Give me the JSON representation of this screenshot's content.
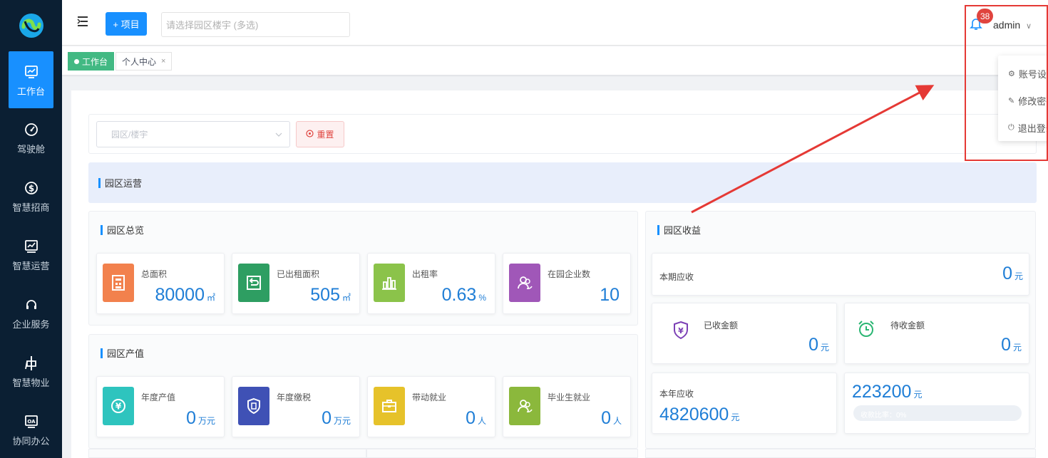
{
  "sidebar": {
    "logo_icon": "brand-logo-icon",
    "items": [
      {
        "label": "工作台",
        "icon": "monitor-chart-icon",
        "active": true
      },
      {
        "label": "驾驶舱",
        "icon": "speedometer-icon",
        "active": false
      },
      {
        "label": "智慧招商",
        "icon": "dollar-coin-icon",
        "active": false
      },
      {
        "label": "智慧运营",
        "icon": "line-chart-icon",
        "active": false
      },
      {
        "label": "企业服务",
        "icon": "headset-icon",
        "active": false
      },
      {
        "label": "智慧物业",
        "icon": "property-icon",
        "active": false
      },
      {
        "label": "协同办公",
        "icon": "oa-icon",
        "active": false
      }
    ]
  },
  "header": {
    "add_button": "+ 项目",
    "park_placeholder": "请选择园区楼宇 (多选)",
    "notification_count": "38",
    "username": "admin",
    "user_chevron": "∨"
  },
  "tags": {
    "workbench": "工作台",
    "personal": "个人中心",
    "close": "×"
  },
  "user_menu": {
    "items": [
      {
        "label": "账号设置",
        "icon": "gear-icon"
      },
      {
        "label": "修改密码",
        "icon": "pen-icon"
      },
      {
        "label": "退出登录",
        "icon": "power-icon"
      }
    ]
  },
  "filter": {
    "park_placeholder": "园区/楼宇",
    "reset_label": "重置"
  },
  "operations": {
    "title": "园区运营"
  },
  "overview": {
    "title": "园区总览",
    "cards": [
      {
        "label": "总面积",
        "value": "80000",
        "unit": "㎡",
        "color": "#f2814d"
      },
      {
        "label": "已出租面积",
        "value": "505",
        "unit": "㎡",
        "color": "#2e9e62"
      },
      {
        "label": "出租率",
        "value": "0.63",
        "unit": "%",
        "color": "#8bc34a"
      },
      {
        "label": "在园企业数",
        "value": "10",
        "unit": "",
        "color": "#a057b8"
      }
    ]
  },
  "output": {
    "title": "园区产值",
    "cards": [
      {
        "label": "年度产值",
        "value": "0",
        "unit": "万元",
        "color": "#2ec4be"
      },
      {
        "label": "年度缴税",
        "value": "0",
        "unit": "万元",
        "color": "#3f51b5"
      },
      {
        "label": "带动就业",
        "value": "0",
        "unit": "人",
        "color": "#e6c22a"
      },
      {
        "label": "毕业生就业",
        "value": "0",
        "unit": "人",
        "color": "#8bb83c"
      }
    ]
  },
  "revenue": {
    "title": "园区收益",
    "current_receivable_label": "本期应收",
    "current_receivable_value": "0",
    "current_receivable_unit": "元",
    "collected_label": "已收金额",
    "collected_value": "0",
    "collected_unit": "元",
    "pending_label": "待收金额",
    "pending_value": "0",
    "pending_unit": "元",
    "annual_receivable_label": "本年应收",
    "annual_receivable_value": "4820600",
    "annual_receivable_unit": "元",
    "annual_collected_value": "223200",
    "annual_collected_unit": "元",
    "progress_text": "收款比率：0%",
    "progress_fraction": 0,
    "colors": {
      "collected": "#7b3fb5",
      "pending": "#2bb673"
    }
  }
}
